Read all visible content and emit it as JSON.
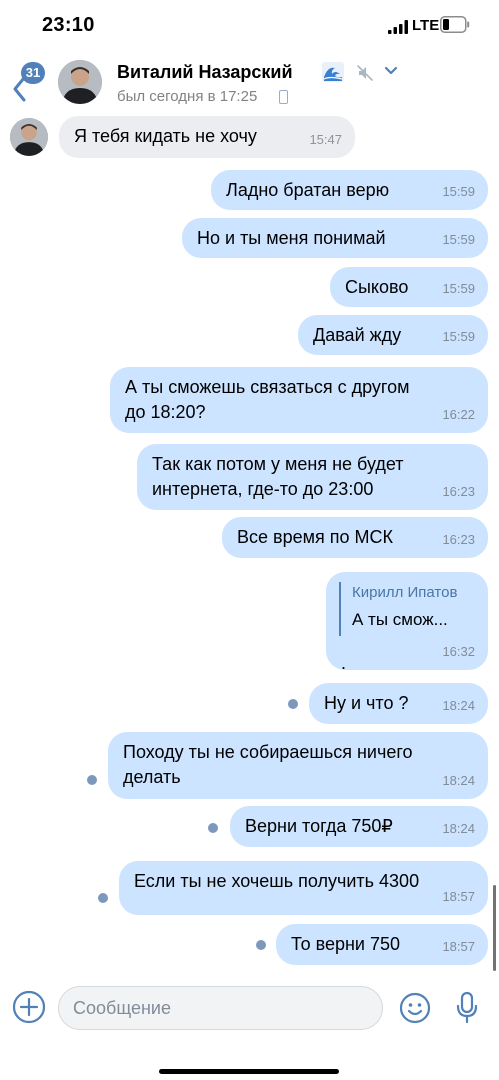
{
  "status_bar": {
    "time": "23:10",
    "network": "LTE"
  },
  "header": {
    "unread_count": "31",
    "contact_name": "Виталий Назарский",
    "last_seen": "был сегодня в 17:25",
    "status_emoji_icon": "wave-icon",
    "muted": true
  },
  "messages": [
    {
      "direction": "in",
      "text": "Я тебя кидать не хочу",
      "time": "15:47"
    },
    {
      "direction": "out",
      "text": "Ладно братан верю",
      "time": "15:59"
    },
    {
      "direction": "out",
      "text": "Но и ты меня понимай",
      "time": "15:59"
    },
    {
      "direction": "out",
      "text": "Сыково",
      "time": "15:59"
    },
    {
      "direction": "out",
      "text": "Давай жду",
      "time": "15:59"
    },
    {
      "direction": "out",
      "text": "А ты сможешь связаться с другом\nдо 18:20?",
      "time": "16:22"
    },
    {
      "direction": "out",
      "text": "Так как потом у меня не будет\nинтернета, где-то до 23:00",
      "time": "16:23"
    },
    {
      "direction": "out",
      "text": "Все время по МСК",
      "time": "16:23"
    },
    {
      "direction": "out",
      "reply_author": "Кирилл Ипатов",
      "reply_text": "А ты смож...",
      "text": ".",
      "time": "16:32"
    },
    {
      "direction": "out",
      "text": "Ну и что ?",
      "time": "18:24",
      "unread": true
    },
    {
      "direction": "out",
      "text": "Походу ты не собираешься ничего\nделать",
      "time": "18:24",
      "unread": true
    },
    {
      "direction": "out",
      "text": "Верни тогда 750₽",
      "time": "18:24",
      "unread": true
    },
    {
      "direction": "out",
      "text": "Если ты не хочешь получить 4300",
      "time": "18:57",
      "unread": true
    },
    {
      "direction": "out",
      "text": "То верни 750",
      "time": "18:57",
      "unread": true
    }
  ],
  "composer": {
    "placeholder": "Сообщение",
    "value": ""
  },
  "colors": {
    "accent": "#5181b8",
    "outgoing_bubble": "#cce4ff",
    "incoming_bubble": "#ebedf0",
    "unread_dot": "#7d98bd"
  }
}
